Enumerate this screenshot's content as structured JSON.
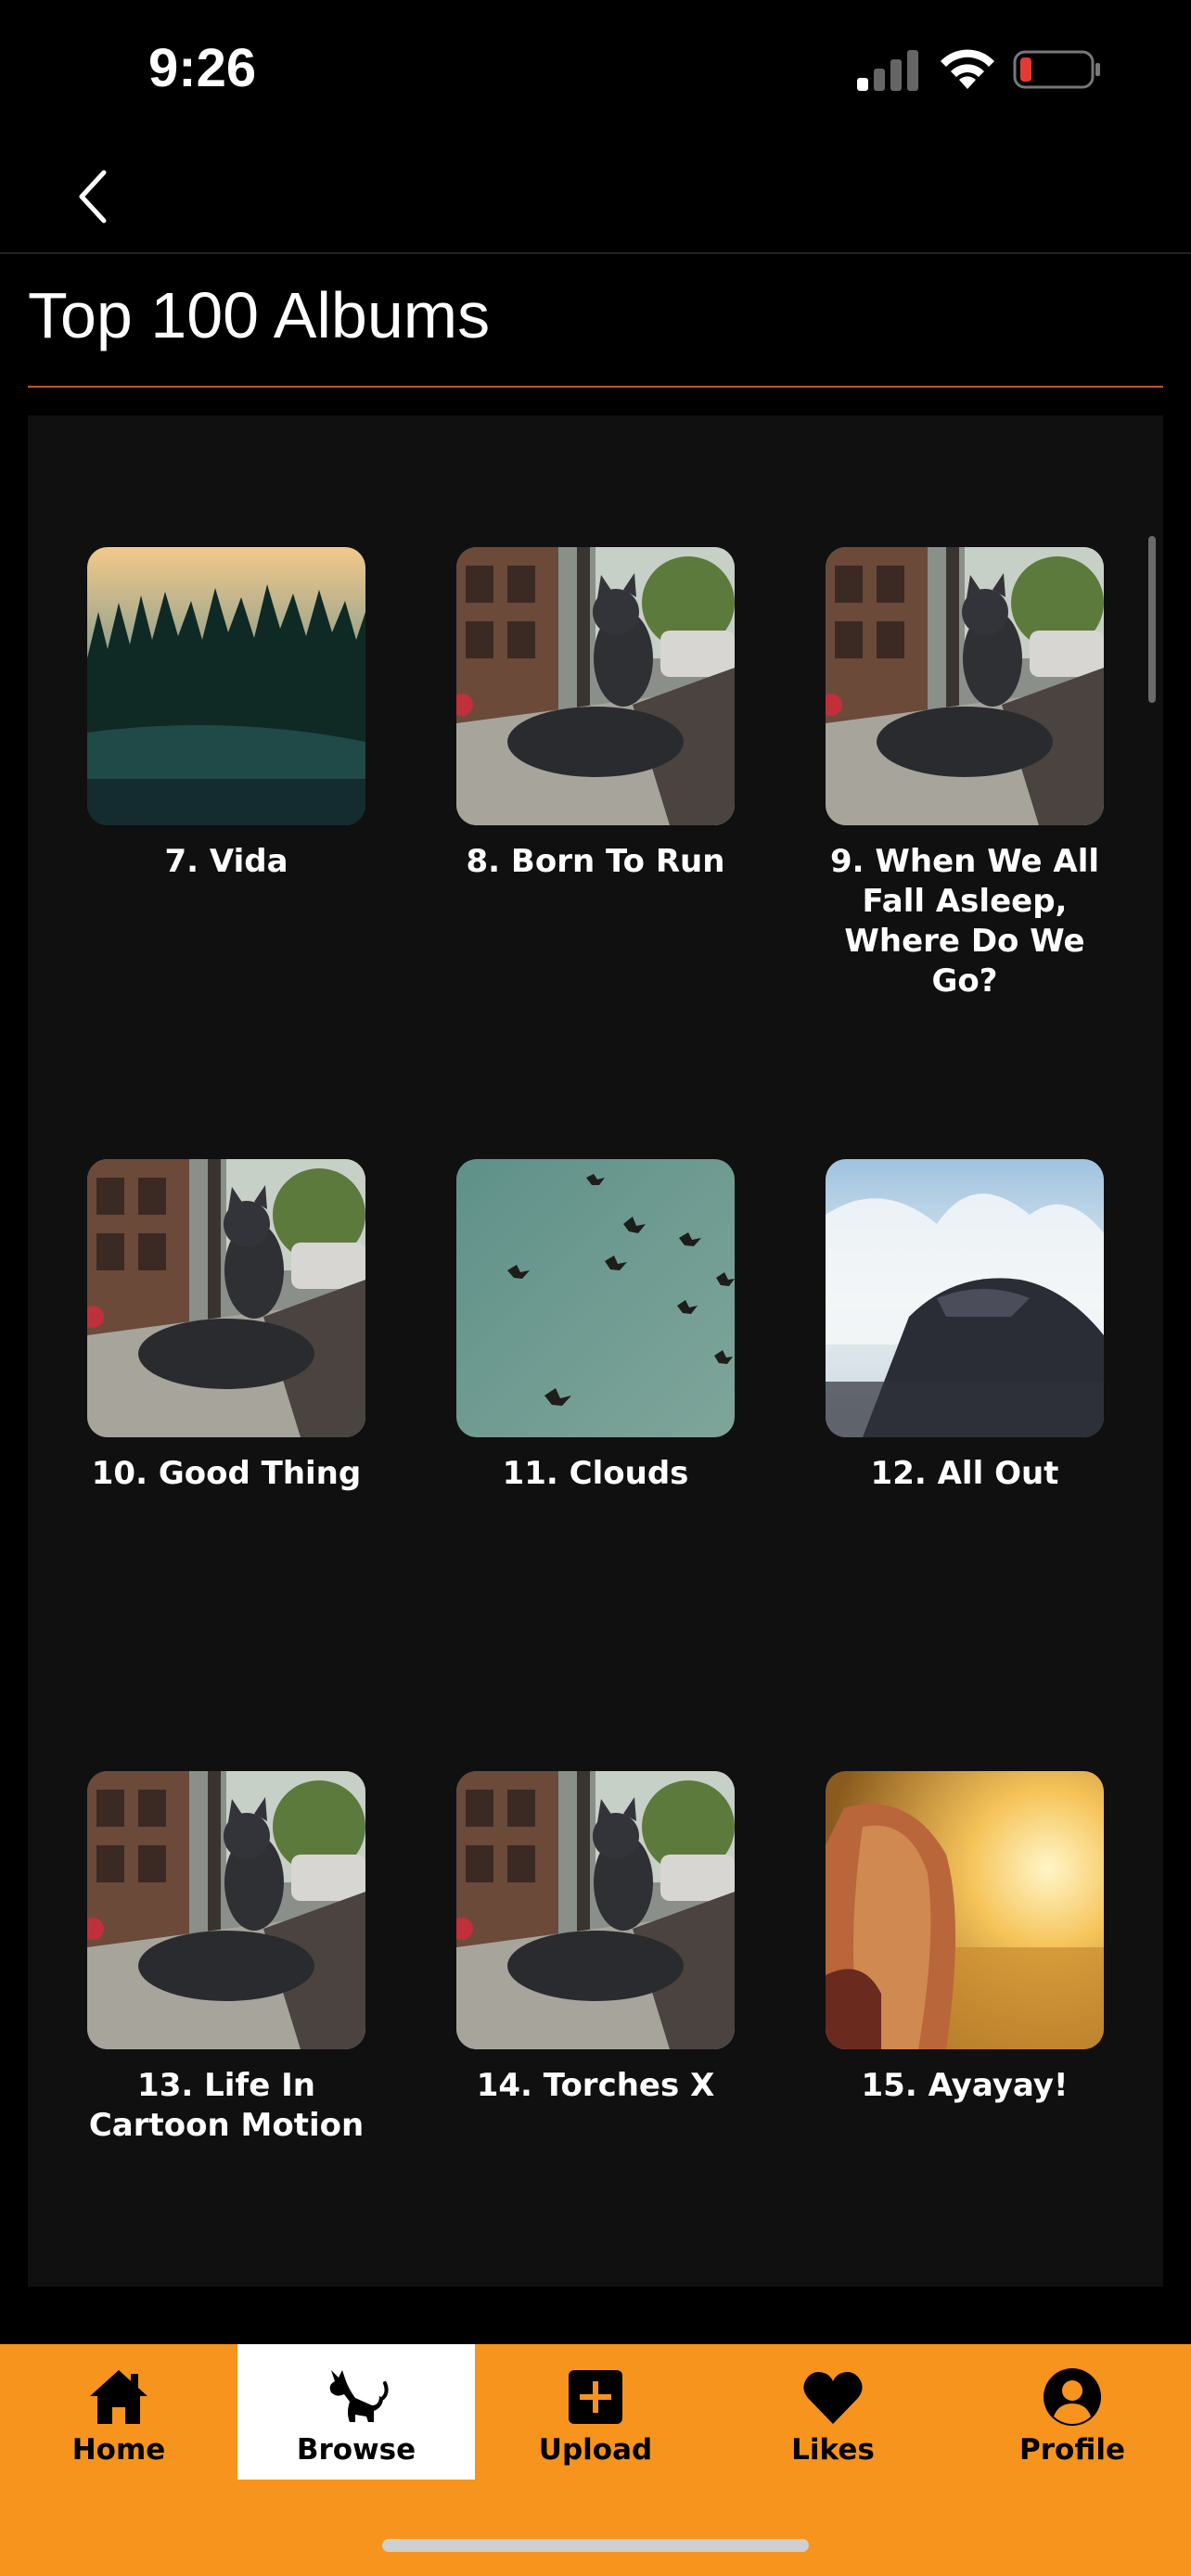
{
  "status_bar": {
    "time": "9:26",
    "battery_color": "#e53935"
  },
  "header": {
    "title": "Top 100 Albums"
  },
  "colors": {
    "accent": "#f7941d",
    "divider": "#c0562a",
    "panel": "#101010"
  },
  "albums": [
    {
      "label": "7. Vida",
      "art": "forest"
    },
    {
      "label": "8. Born To Run",
      "art": "cat-statue"
    },
    {
      "label": "9. When We All Fall Asleep, Where Do We Go?",
      "art": "cat-statue"
    },
    {
      "label": "10. Good Thing",
      "art": "cat-statue"
    },
    {
      "label": "11. Clouds",
      "art": "birds"
    },
    {
      "label": "12. All Out",
      "art": "wave-rock"
    },
    {
      "label": "13. Life In Cartoon Motion",
      "art": "cat-statue"
    },
    {
      "label": "14. Torches X",
      "art": "cat-statue"
    },
    {
      "label": "15. Ayayay!",
      "art": "girl-sunset"
    }
  ],
  "tabs": [
    {
      "label": "Home",
      "icon": "home-icon",
      "active": false
    },
    {
      "label": "Browse",
      "icon": "cat-icon",
      "active": true
    },
    {
      "label": "Upload",
      "icon": "plus-square-icon",
      "active": false
    },
    {
      "label": "Likes",
      "icon": "heart-icon",
      "active": false
    },
    {
      "label": "Profile",
      "icon": "profile-icon",
      "active": false
    }
  ]
}
